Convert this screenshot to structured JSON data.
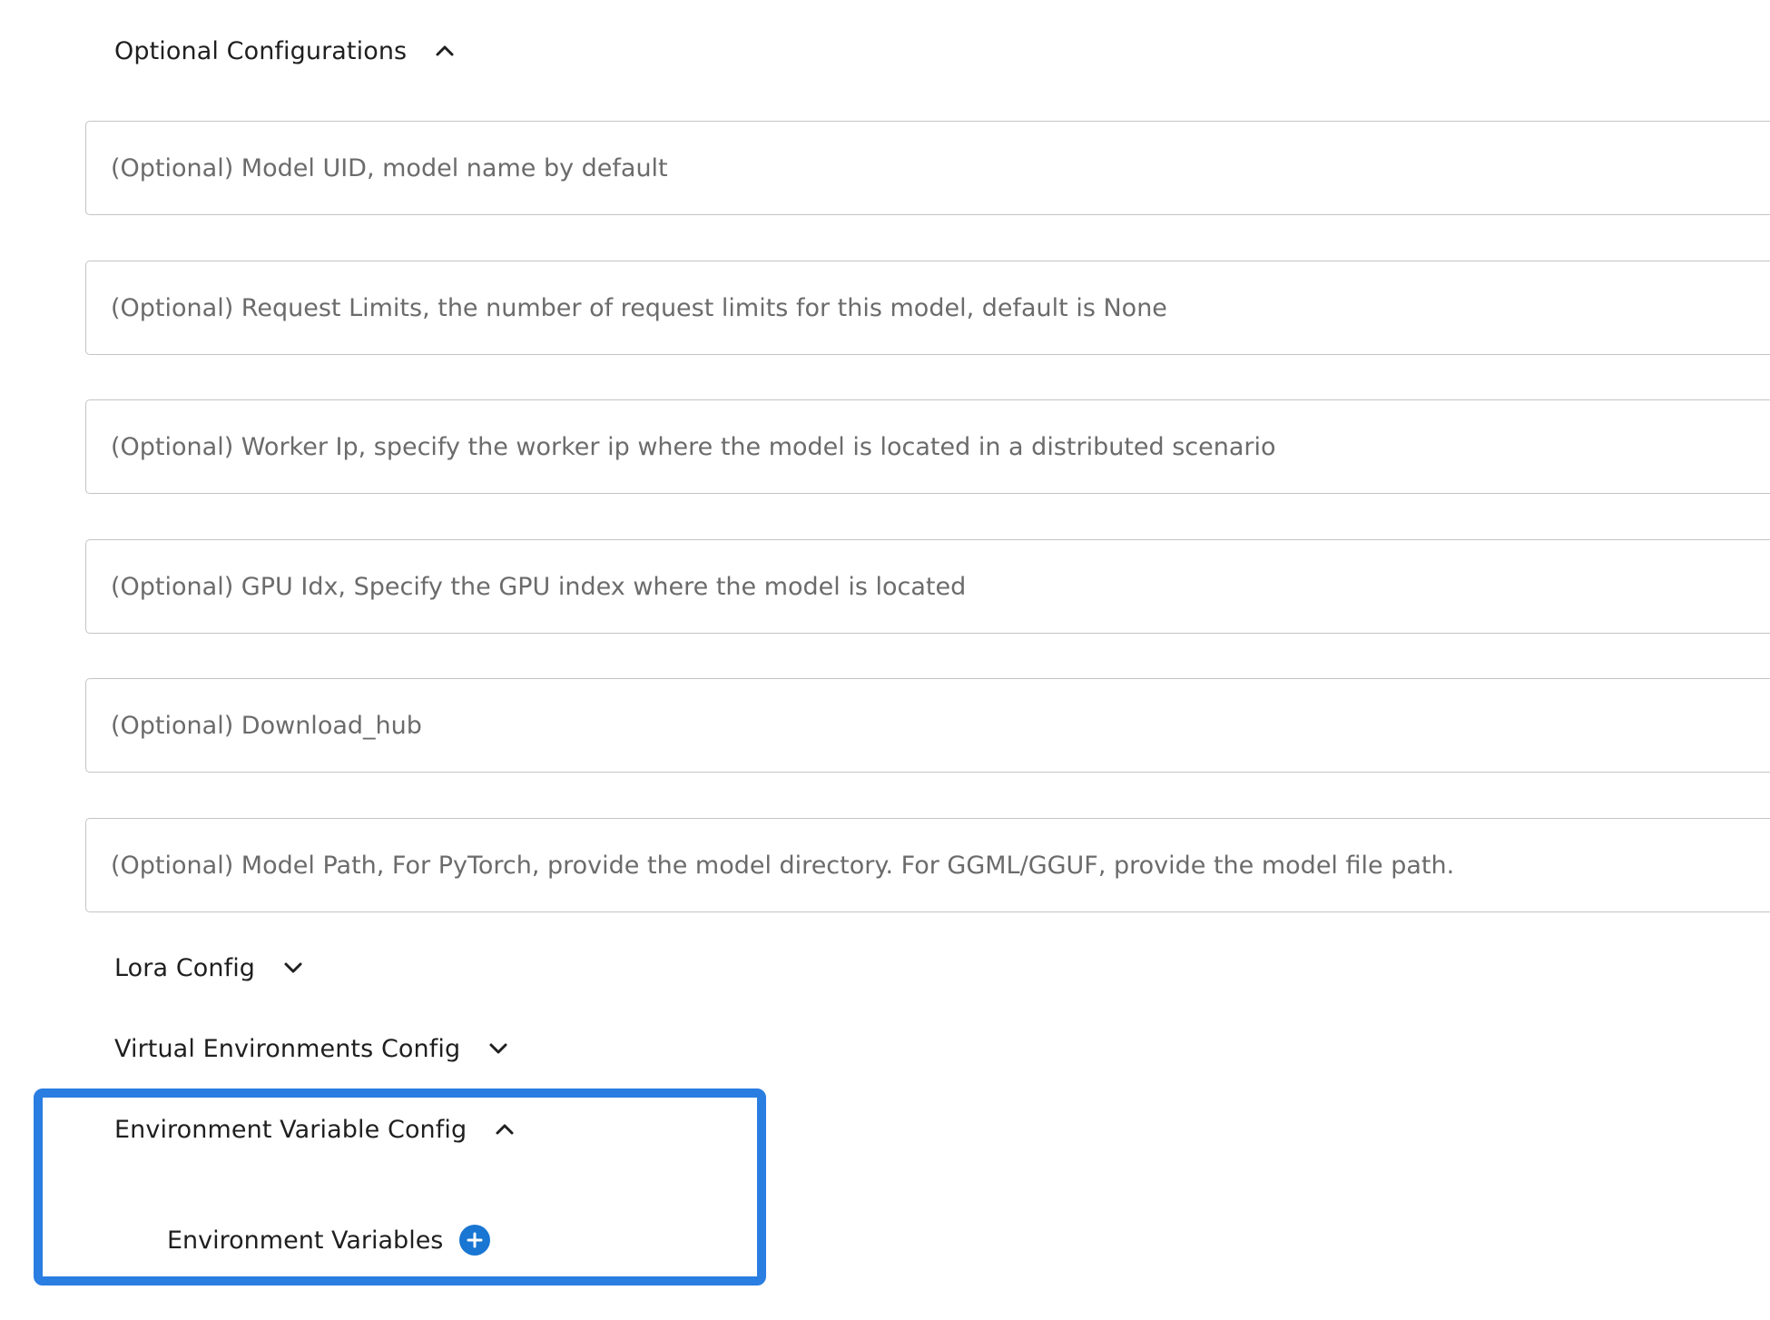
{
  "sections": {
    "optional_configurations": {
      "label": "Optional Configurations",
      "expanded": true
    },
    "lora_config": {
      "label": "Lora Config",
      "expanded": false
    },
    "virtual_env_config": {
      "label": "Virtual Environments Config",
      "expanded": false
    },
    "env_variable_config": {
      "label": "Environment Variable Config",
      "expanded": true
    }
  },
  "fields": {
    "model_uid": {
      "placeholder": "(Optional) Model UID, model name by default",
      "value": ""
    },
    "request_limits": {
      "placeholder": "(Optional) Request Limits, the number of request limits for this model, default is None",
      "value": ""
    },
    "worker_ip": {
      "placeholder": "(Optional) Worker Ip, specify the worker ip where the model is located in a distributed scenario",
      "value": ""
    },
    "gpu_idx": {
      "placeholder": "(Optional) GPU Idx, Specify the GPU index where the model is located",
      "value": ""
    },
    "download_hub": {
      "placeholder": "(Optional) Download_hub",
      "value": ""
    },
    "model_path": {
      "placeholder": "(Optional) Model Path, For PyTorch, provide the model directory. For GGML/GGUF, provide the model file path.",
      "value": ""
    }
  },
  "env_variables": {
    "label": "Environment Variables",
    "add_icon": "add-circle-icon"
  },
  "icons": {
    "expanded": "chevron-up-icon",
    "collapsed": "chevron-down-icon"
  },
  "colors": {
    "highlight": "#2a7de1",
    "add_button": "#1976d2",
    "border": "#c4c4c4",
    "placeholder": "#6b6b6b"
  }
}
